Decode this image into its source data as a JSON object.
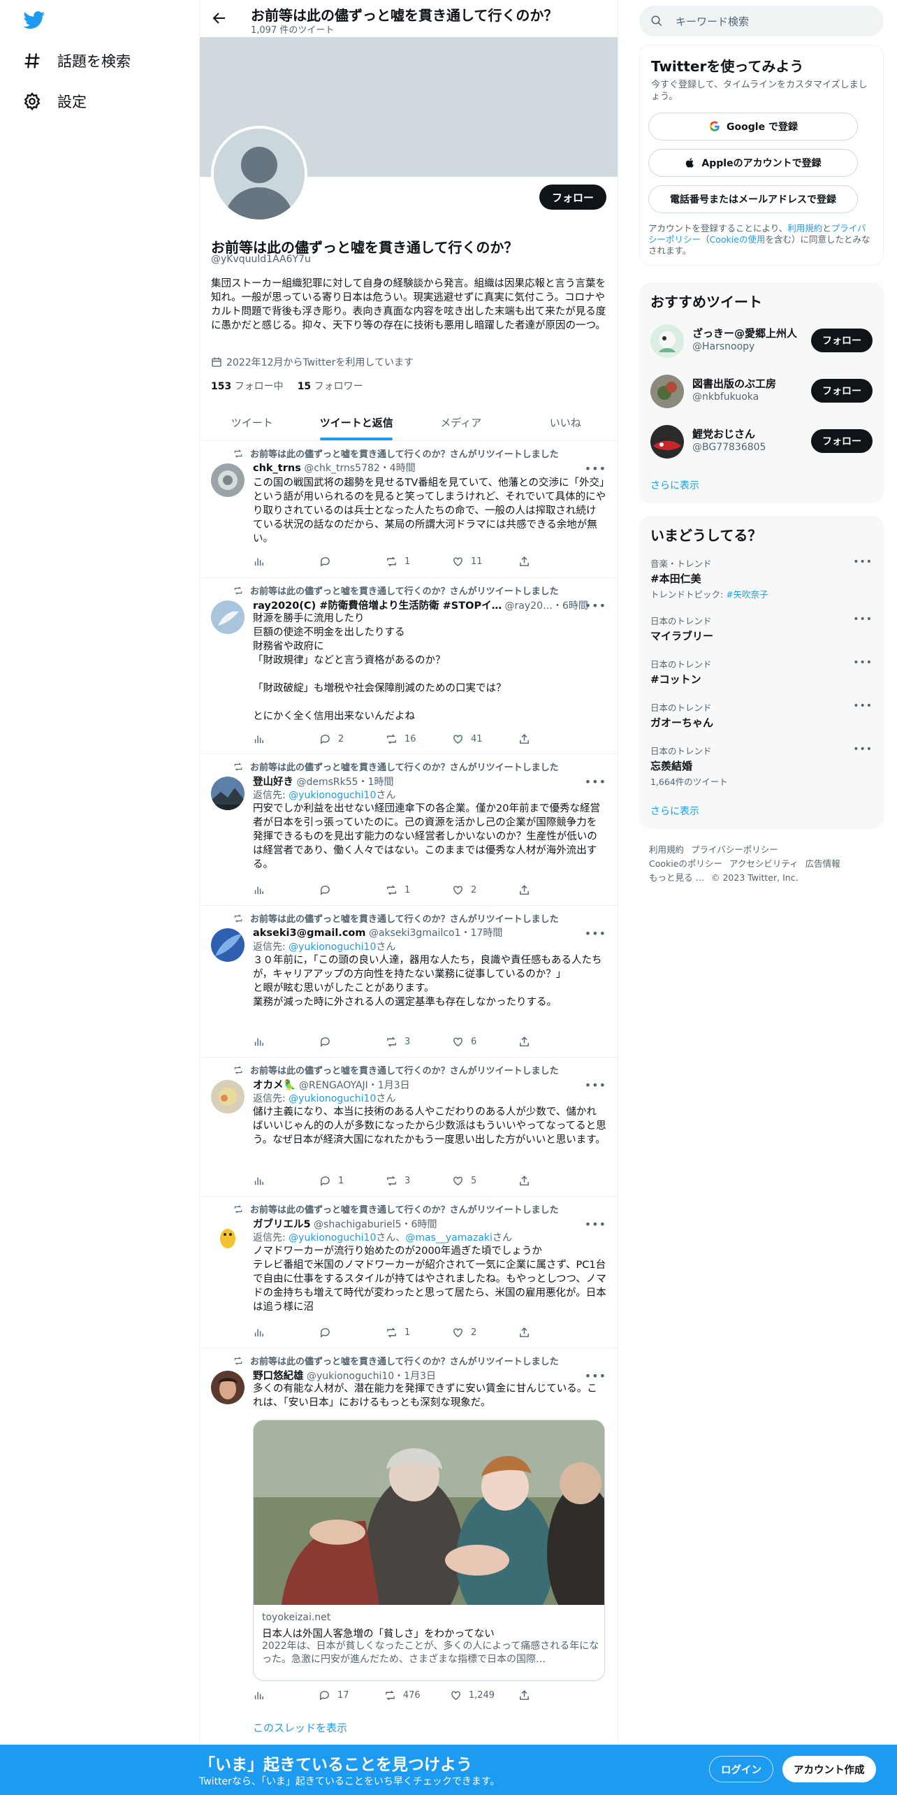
{
  "nav": {
    "explore": "話題を検索",
    "settings": "設定"
  },
  "header": {
    "title": "お前等は此の儘ずっと嘘を貫き通して行くのか？",
    "tweet_count": "1,097 件のツイート"
  },
  "profile": {
    "follow_button": "フォロー",
    "name": "お前等は此の儘ずっと嘘を貫き通して行くのか？",
    "handle": "@yKvquuld1AA6Y7u",
    "bio": "集団ストーカー組織犯罪に対して自身の経験談から発言。組織は因果応報と言う言葉を知れ。一般が思っている寄り日本は危うい。現実逃避せずに真実に気付こう。コロナやカルト問題で背後も浮き彫り。表向き真面な内容を呟き出した末端も出て来たが見る度に愚かだと感じる。抑々、天下り等の存在に技術も悪用し暗躍した者達が原因の一つ。",
    "joined": "2022年12月からTwitterを利用しています",
    "following_count": "153",
    "following_label": "フォロー中",
    "followers_count": "15",
    "followers_label": "フォロワー"
  },
  "tabs": [
    {
      "label": "ツイート"
    },
    {
      "label": "ツイートと返信"
    },
    {
      "label": "メディア"
    },
    {
      "label": "いいね"
    }
  ],
  "retweet_label": "お前等は此の儘ずっと嘘を貫き通して行くのか？さんがリツイートしました",
  "reply_prefix": "返信先:",
  "reply_suffix": "さん",
  "tweets": [
    {
      "name": "chk_trns",
      "handle": "@chk_trns5782",
      "time": "・4時間",
      "text": "この国の戦国武将の趨勢を見せるTV番組を見ていて、他藩との交渉に「外交」という語が用いられるのを見ると笑ってしまうけれど、それでいて具体的にやり取りされているのは兵士となった人たちの命で、一般の人は搾取され続けている状況の話なのだから、某局の所謂大河ドラマには共感できる余地が無い。",
      "replies": "",
      "retweets": "1",
      "likes": "11"
    },
    {
      "name": "ray2020(C) #防衛費倍増より生活防衛 #STOPイ…",
      "handle": "@ray20…",
      "time": "・6時間",
      "text": "財源を勝手に流用したり\n巨額の使途不明金を出したりする\n財務省や政府に\n「財政規律」などと言う資格があるのか？\n\n「財政破綻」も増税や社会保障削減のための口実では？\n\nとにかく全く信用出来ないんだよね",
      "replies": "2",
      "retweets": "16",
      "likes": "41"
    },
    {
      "name": "登山好き",
      "handle": "@demsRk55",
      "time": "・1時間",
      "reply_to": "@yukionoguchi10",
      "text": "円安でしか利益を出せない経団連傘下の各企業。僅か20年前まで優秀な経営者が日本を引っ張っていたのに。己の資源を活かし己の企業が国際競争力を発揮できるものを見出す能力のない経営者しかいないのか？生産性が低いのは経営者であり、働く人々ではない。このままでは優秀な人材が海外流出する。",
      "replies": "",
      "retweets": "1",
      "likes": "2"
    },
    {
      "name": "akseki3@gmail.com",
      "handle": "@akseki3gmailco1",
      "time": "・17時間",
      "reply_to": "@yukionoguchi10",
      "text": "３０年前に，「この頭の良い人達，器用な人たち，良識や責任感もある人たちが，キャリアアップの方向性を持たない業務に従事しているのか？」\nと眼が眩む思いがしたことがあります。\n業務が減った時に外される人の選定基準も存在しなかったりする。",
      "replies": "",
      "retweets": "3",
      "likes": "6"
    },
    {
      "name": "オカメ🦜",
      "handle": "@RENGAOYAJI",
      "time": "・1月3日",
      "reply_to": "@yukionoguchi10",
      "text": "儲け主義になり、本当に技術のある人やこだわりのある人が少数で、儲かればいいじゃん的の人が多数になったから少数派はもういいやってなってると思う。なぜ日本が経済大国になれたかもう一度思い出した方がいいと思います。",
      "replies": "1",
      "retweets": "3",
      "likes": "5"
    },
    {
      "name": "ガブリエル5",
      "handle": "@shachigaburiel5",
      "time": "・6時間",
      "reply_to": "@yukionoguchi10",
      "reply_to_2": "@mas__yamazaki",
      "reply_joiner": "さん、",
      "text": "ノマドワーカーが流行り始めたのが2000年過ぎた頃でしょうか\nテレビ番組で米国のノマドワーカーが紹介されて一気に企業に属さず、PC1台で自由に仕事をするスタイルが持てはやされましたね。もやっとしつつ、ノマドの金持ちも増えて時代が変わったと思って居たら、米国の雇用悪化が。日本は追う様に沼",
      "replies": "",
      "retweets": "1",
      "likes": "2"
    },
    {
      "name": "野口悠紀雄",
      "handle": "@yukionoguchi10",
      "time": "・1月3日",
      "text": "多くの有能な人材が、潜在能力を発揮できずに安い賃金に甘んじている。これは、「安い日本」におけるもっとも深刻な現象だ。",
      "card": {
        "domain": "toyokeizai.net",
        "title": "日本人は外国人客急増の「貧しさ」をわかってない",
        "description": "2022年は、日本が貧しくなったことが、多くの人によって痛感される年になった。急激に円安が進んだため、さまざまな指標で日本の国際…"
      },
      "replies": "17",
      "retweets": "476",
      "likes": "1,249",
      "show_thread": "このスレッドを表示"
    }
  ],
  "right": {
    "search_placeholder": "キーワード検索",
    "signup": {
      "title": "Twitterを使ってみよう",
      "subtitle": "今すぐ登録して、タイムラインをカスタマイズしましょう。",
      "google": "Google で登録",
      "apple": "Appleのアカウントで登録",
      "phone": "電話番号またはメールアドレスで登録",
      "terms_1": "アカウントを登録することにより、",
      "terms_link_1": "利用規約",
      "terms_2": "と",
      "terms_link_2": "プライバシーポリシー",
      "terms_3": "（",
      "terms_link_3": "Cookieの使用",
      "terms_4": "を含む）に同意したとみなされます。"
    },
    "recommended": {
      "title": "おすすめツイート",
      "users": [
        {
          "name": "ざっきー@愛郷上州人",
          "handle": "@Harsnoopy",
          "button": "フォロー"
        },
        {
          "name": "図書出版のぶ工房",
          "handle": "@nkbfukuoka",
          "button": "フォロー"
        },
        {
          "name": "鯉党おじさん",
          "handle": "@BG77836805",
          "button": "フォロー"
        }
      ],
      "more": "さらに表示"
    },
    "trends": {
      "title": "いまどうしてる？",
      "items": [
        {
          "category": "音楽・トレンド",
          "name": "#本田仁美",
          "sub_prefix": "トレンドトピック: ",
          "sub_link": "#矢吹奈子"
        },
        {
          "category": "日本のトレンド",
          "name": "マイラブリー"
        },
        {
          "category": "日本のトレンド",
          "name": "#コットン"
        },
        {
          "category": "日本のトレンド",
          "name": "ガオーちゃん"
        },
        {
          "category": "日本のトレンド",
          "name": "忘羨結婚",
          "count": "1,664件のツイート"
        }
      ],
      "more": "さらに表示"
    },
    "footer": {
      "terms": "利用規約",
      "privacy": "プライバシーポリシー",
      "cookie": "Cookieのポリシー",
      "accessibility": "アクセシビリティ",
      "ads": "広告情報",
      "more": "もっと見る …",
      "copyright": "© 2023 Twitter, Inc."
    }
  },
  "bottom_bar": {
    "title": "「いま」起きていることを見つけよう",
    "subtitle": "Twitterなら、「いま」起きていることをいち早くチェックできます。",
    "login": "ログイン",
    "signup": "アカウント作成"
  },
  "colors": {
    "accent": "#1d9bf0",
    "text": "#0f1419",
    "muted": "#536471"
  }
}
